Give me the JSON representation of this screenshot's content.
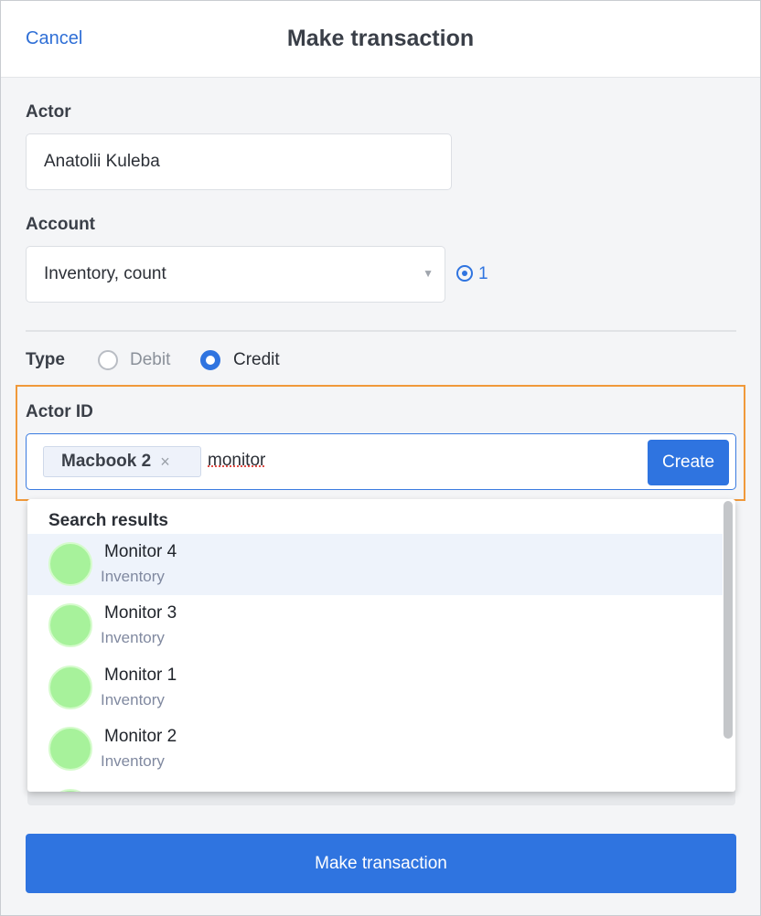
{
  "header": {
    "cancel": "Cancel",
    "title": "Make transaction"
  },
  "actor": {
    "label": "Actor",
    "value": "Anatolii Kuleba"
  },
  "account": {
    "label": "Account",
    "value": "Inventory, count",
    "badge_count": "1"
  },
  "type": {
    "label": "Type",
    "options": [
      "Debit",
      "Credit"
    ],
    "selected": "Credit"
  },
  "actor_id": {
    "label": "Actor ID",
    "chip": "Macbook 2",
    "chip_remove": "×",
    "input_value": "monitor",
    "create_label": "Create"
  },
  "search": {
    "heading": "Search results",
    "results": [
      {
        "name": "Monitor 4",
        "category": "Inventory"
      },
      {
        "name": "Monitor 3",
        "category": "Inventory"
      },
      {
        "name": "Monitor 1",
        "category": "Inventory"
      },
      {
        "name": "Monitor 2",
        "category": "Inventory"
      }
    ]
  },
  "submit": "Make transaction",
  "colors": {
    "accent": "#2f74e0",
    "highlight": "#f0993a",
    "avatar": "#a7f29b"
  }
}
